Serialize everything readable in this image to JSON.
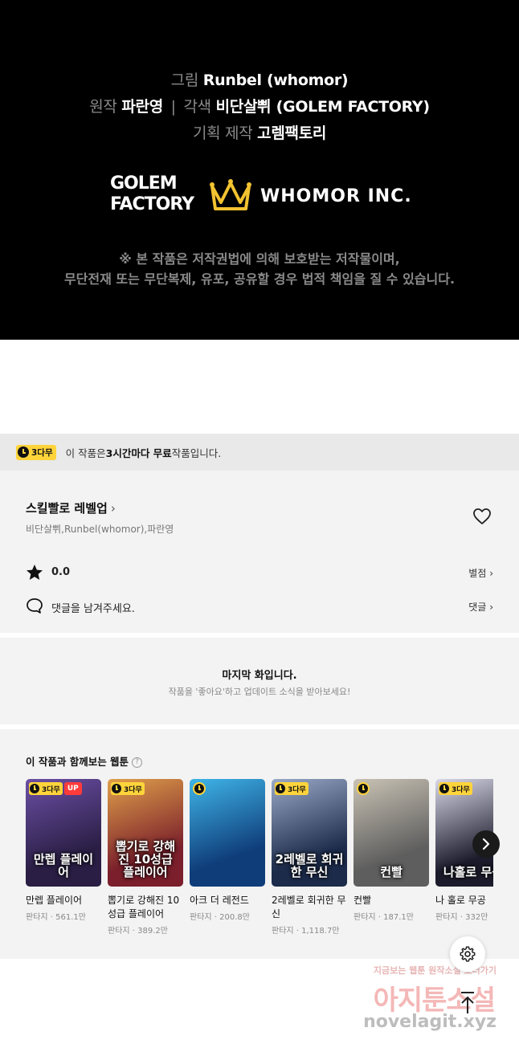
{
  "credits": {
    "line1": {
      "label": "그림",
      "name": "Runbel (whomor)"
    },
    "line2": {
      "label1": "원작",
      "name1": "파란영",
      "separator": "|",
      "label2": "각색",
      "name2": "비단살쀠 (GOLEM FACTORY)"
    },
    "line3": {
      "label": "기획 제작",
      "name": "고렘팩토리"
    },
    "logo_golem_line1": "GOLEM",
    "logo_golem_line2": "FACTORY",
    "logo_whomor": "WHOMOR INC.",
    "notice_line1": "※ 본 작품은 저작권법에 의해 보호받는 저작물이며,",
    "notice_line2": "무단전재 또는 무단복제, 유포, 공유할 경우 법적 책임을 질 수 있습니다."
  },
  "free_banner": {
    "badge": "3다무",
    "text_before": "이 작품은 ",
    "text_bold": "3시간마다 무료",
    "text_after": " 작품입니다."
  },
  "series": {
    "title": "스킬빨로 레벨업",
    "chevron": "›",
    "authors": "비단살쀠,Runbel(whomor),파란영",
    "rating": "0.0",
    "rating_link": "별점 ›",
    "comment_prompt": "댓글을 남겨주세요.",
    "comment_link": "댓글 ›"
  },
  "last_episode": {
    "title": "마지막 화입니다.",
    "subtitle": "작품을 '좋아요'하고 업데이트 소식을 받아보세요!"
  },
  "recommendations": {
    "title": "이 작품과 함께보는 웹툰",
    "help": "?",
    "items": [
      {
        "title": "만렙 플레이어",
        "meta": "판타지 · 561.1만",
        "badge": "3다무",
        "up": "UP",
        "cover": "만렙 플레이어",
        "bg1": "#2a1e44",
        "bg2": "#6b4fa5"
      },
      {
        "title": "뽑기로 강해진 10성급 플레이어",
        "meta": "판타지 · 389.2만",
        "badge": "3다무",
        "up": "",
        "cover": "뽑기로 강해진 10성급 플레이어",
        "bg1": "#7a1f2b",
        "bg2": "#e0a04a"
      },
      {
        "title": "아크 더 레전드",
        "meta": "판타지 · 200.8만",
        "badge": "",
        "up": "",
        "cover": "",
        "bg1": "#0f3d7a",
        "bg2": "#3fb5e8"
      },
      {
        "title": "2레벨로 회귀한 무신",
        "meta": "판타지 · 1,118.7만",
        "badge": "3다무",
        "up": "",
        "cover": "2레벨로 회귀한 무신",
        "bg1": "#1c2b4a",
        "bg2": "#9aa9c7"
      },
      {
        "title": "컨빨",
        "meta": "판타지 · 187.1만",
        "badge": "",
        "up": "",
        "cover": "컨빨",
        "bg1": "#5e5e5e",
        "bg2": "#c9c2b4"
      },
      {
        "title": "나 홀로 무공",
        "meta": "판타지 · 332만",
        "badge": "3다무",
        "up": "",
        "cover": "나홀로 무공",
        "bg1": "#1b1b2b",
        "bg2": "#d8d8e8"
      }
    ]
  },
  "watermark": {
    "line1": "지금보는 웹툰 원작소설 보러가기",
    "line2": "아지툰소설",
    "line3": "novelagit.xyz"
  },
  "colors": {
    "accent_yellow": "#ffd43b",
    "up_red": "#ff3b3b",
    "panel_bg": "#f3f3f3",
    "banner_bg": "#e9e9e9"
  }
}
